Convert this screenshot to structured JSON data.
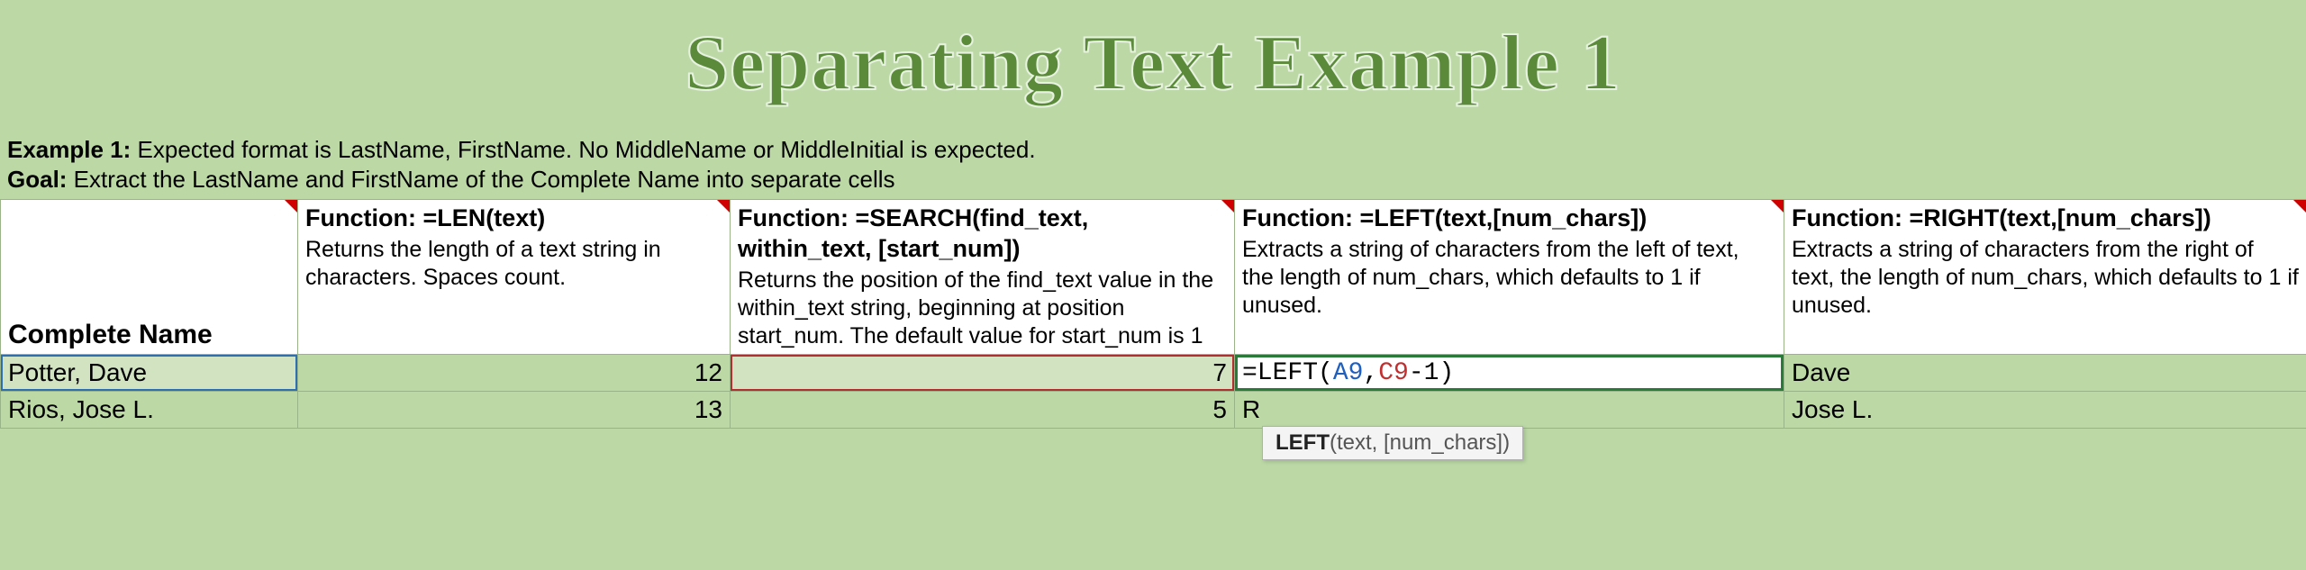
{
  "title": "Separating Text Example 1",
  "desc": {
    "line1_label": "Example 1:",
    "line1_text": " Expected format is LastName, FirstName. No MiddleName or MiddleInitial is expected.",
    "line2_label": "Goal:",
    "line2_text": " Extract the LastName and FirstName of the Complete Name into separate cells"
  },
  "headers": {
    "colA": "Complete Name",
    "colB_fn": "Function:    =LEN(text)",
    "colB_desc": "Returns the length of a text string in characters. Spaces count.",
    "colC_fn": "Function:   =SEARCH(find_text, within_text, [start_num])",
    "colC_desc": "Returns the position of the find_text value in the within_text string, beginning at position start_num. The default value for start_num is 1",
    "colD_fn": "Function:  =LEFT(text,[num_chars])",
    "colD_desc": "Extracts a string of characters from the left of text, the length of num_chars, which defaults to 1 if unused.",
    "colE_fn": "Function:   =RIGHT(text,[num_chars])",
    "colE_desc": "Extracts a string of characters from the right of text, the length of num_chars, which defaults to 1 if unused."
  },
  "rows": [
    {
      "name": "Potter, Dave",
      "len": "12",
      "search": "7",
      "left_prefix": "=LEFT(",
      "left_ref1": "A9",
      "left_sep": ",",
      "left_ref2": "C9",
      "left_suffix": "-1)",
      "right": "Dave"
    },
    {
      "name": "Rios, Jose L.",
      "len": "13",
      "search": "5",
      "left": "R",
      "right": "Jose L."
    }
  ],
  "tooltip": {
    "bold": "LEFT",
    "rest": "(text, [num_chars])"
  }
}
